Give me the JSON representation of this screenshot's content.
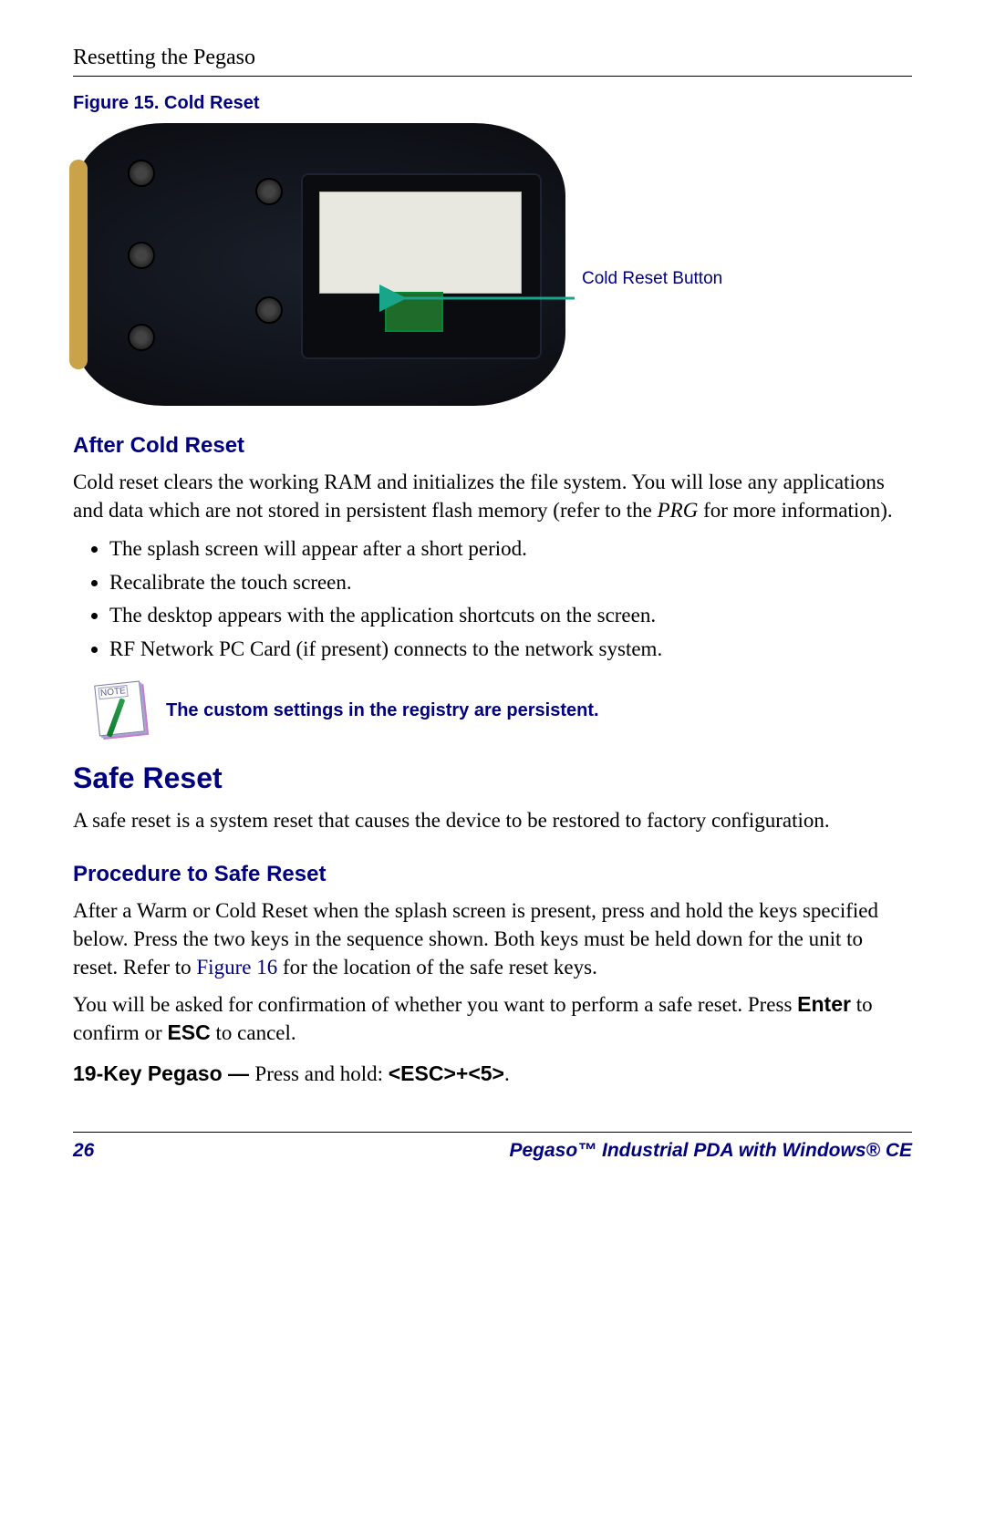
{
  "header": "Resetting the Pegaso",
  "figure": {
    "caption": "Figure 15. Cold Reset",
    "callout": "Cold Reset Button"
  },
  "after_cold_reset": {
    "heading": "After Cold Reset",
    "para_part1": "Cold reset clears the working RAM and initializes the file system. You will lose any applications and data which are not stored in persistent flash memory (refer to the ",
    "para_italic": "PRG",
    "para_part2": " for more information).",
    "bullets": [
      "The splash screen will appear after a short period.",
      "Recalibrate the touch screen.",
      "The desktop appears with the application shortcuts on the screen.",
      "RF Network PC Card (if present) connects to the network system."
    ],
    "note": "The custom settings in the registry are persistent."
  },
  "safe_reset": {
    "heading": "Safe Reset",
    "intro": "A safe reset is a system reset that causes the device to be restored to factory configuration.",
    "proc_heading": "Procedure to Safe Reset",
    "proc_p1_a": "After a Warm or Cold Reset when the splash screen is present, press and hold the keys specified below. Press the two keys in the sequence shown. Both keys must be held down for the unit to reset. Refer to ",
    "proc_p1_figref": "Figure 16",
    "proc_p1_b": " for the location of the safe reset keys.",
    "proc_p2_a": "You will be asked for confirmation of whether you want to perform a safe reset. Press ",
    "proc_p2_enter": "Enter",
    "proc_p2_b": " to confirm or ",
    "proc_p2_esc": "ESC",
    "proc_p2_c": " to cancel.",
    "key_label": "19-Key Pegaso — ",
    "key_instr_a": "Press and hold: ",
    "key_combo": "<ESC>+<5>",
    "key_instr_b": "."
  },
  "footer": {
    "page": "26",
    "title": "Pegaso™ Industrial PDA with Windows® CE"
  }
}
